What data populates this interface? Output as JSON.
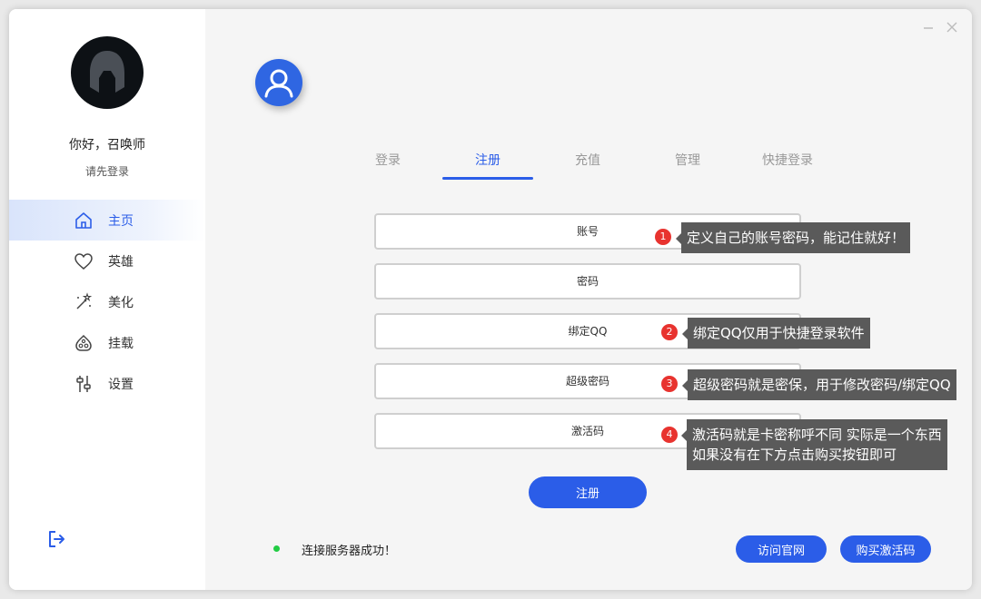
{
  "sidebar": {
    "greeting": "你好，召唤师",
    "login_hint": "请先登录",
    "items": [
      {
        "label": "主页",
        "icon": "home-icon",
        "active": true
      },
      {
        "label": "英雄",
        "icon": "heart-icon",
        "active": false
      },
      {
        "label": "美化",
        "icon": "magic-wand-icon",
        "active": false
      },
      {
        "label": "挂载",
        "icon": "mount-icon",
        "active": false
      },
      {
        "label": "设置",
        "icon": "sliders-icon",
        "active": false
      }
    ],
    "logout_icon": "logout-icon"
  },
  "tabs": [
    {
      "label": "登录",
      "active": false
    },
    {
      "label": "注册",
      "active": true
    },
    {
      "label": "充值",
      "active": false
    },
    {
      "label": "管理",
      "active": false
    },
    {
      "label": "快捷登录",
      "active": false
    }
  ],
  "form": {
    "account_placeholder": "账号",
    "password_placeholder": "密码",
    "qq_placeholder": "绑定QQ",
    "super_password_placeholder": "超级密码",
    "activation_code_placeholder": "激活码",
    "submit_label": "注册"
  },
  "tips": [
    {
      "number": "1",
      "lines": [
        "定义自己的账号密码，能记住就好！"
      ]
    },
    {
      "number": "2",
      "lines": [
        "绑定QQ仅用于快捷登录软件"
      ]
    },
    {
      "number": "3",
      "lines": [
        "超级密码就是密保，用于修改密码/绑定QQ"
      ]
    },
    {
      "number": "4",
      "lines": [
        "激活码就是卡密称呼不同 实际是一个东西",
        "如果没有在下方点击购买按钮即可"
      ]
    }
  ],
  "footer": {
    "status_text": "连接服务器成功！",
    "visit_site_label": "访问官网",
    "buy_code_label": "购买激活码"
  },
  "colors": {
    "accent": "#2b5de8",
    "tip_bg": "#5a5a5a",
    "tip_badge": "#e8332f",
    "status_ok": "#22cc44"
  }
}
